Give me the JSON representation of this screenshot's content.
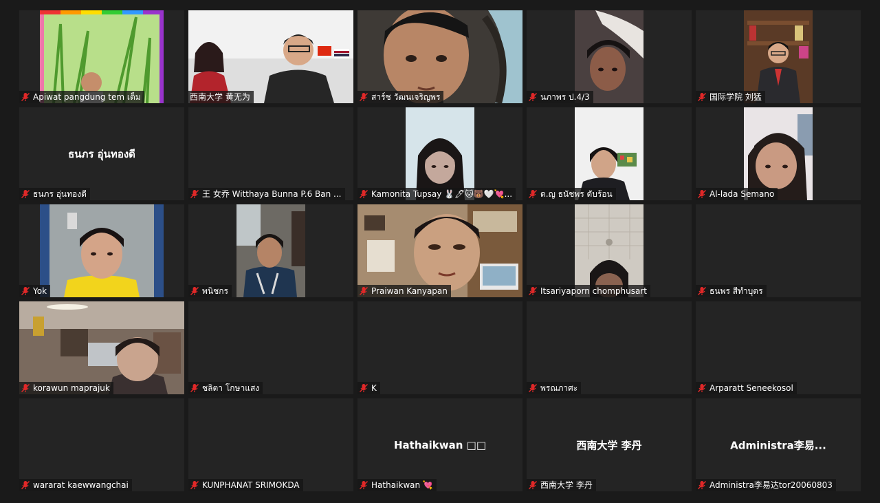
{
  "colors": {
    "background": "#1a1a1a",
    "tile": "#242424",
    "active_speaker_border": "#e5ee6b",
    "muted_icon": "#e02828"
  },
  "participants": [
    {
      "name": "Apiwat pangdung tem เต็ม",
      "muted": true,
      "video": "on",
      "scene": "grass"
    },
    {
      "name": "西南大学 黄无为",
      "muted": false,
      "video": "on",
      "active_speaker": true,
      "scene": "office-flags"
    },
    {
      "name": "สาร์ช วัฒนเจริญพร",
      "muted": true,
      "video": "on",
      "scene": "boy-car"
    },
    {
      "name": "นภาพร  ป.4/3",
      "muted": true,
      "video": "on",
      "scene": "girl-bed"
    },
    {
      "name": "国际学院 刘猛",
      "muted": true,
      "video": "on",
      "scene": "man-bookshelf"
    },
    {
      "name": "ธนภร อุ่นทองดี",
      "center_name": "ธนภร อุ่นทองดี",
      "muted": true,
      "video": "off"
    },
    {
      "name": "王  女乔 Witthaya Bunna P.6 Ban ...",
      "muted": true,
      "video": "off",
      "center_name": ""
    },
    {
      "name": "Kamonita  Tupsay 🐰🖊🐱🐻🤍💘...",
      "muted": true,
      "video": "on",
      "scene": "girl-pale"
    },
    {
      "name": "ด.ญ ธนัชพร ดับร้อน",
      "muted": true,
      "video": "on",
      "scene": "girl-room"
    },
    {
      "name": "Al-lada Semano",
      "muted": true,
      "video": "on",
      "scene": "girl-close"
    },
    {
      "name": "Yok",
      "muted": true,
      "video": "on",
      "scene": "girl-yellow"
    },
    {
      "name": "พนิชกร",
      "muted": true,
      "video": "on",
      "scene": "girl-outdoor"
    },
    {
      "name": "Praiwan Kanyapan",
      "muted": true,
      "video": "on",
      "scene": "man-room"
    },
    {
      "name": "Itsariyaporn chomphusart",
      "muted": true,
      "video": "on",
      "scene": "ceiling"
    },
    {
      "name": "ธนพร สีทำบุตร",
      "muted": true,
      "video": "off",
      "center_name": ""
    },
    {
      "name": "korawun  maprajuk",
      "muted": true,
      "video": "on",
      "scene": "girl-home"
    },
    {
      "name": "ชลิตา โกษาแสง",
      "muted": true,
      "video": "off",
      "center_name": ""
    },
    {
      "name": "K",
      "muted": true,
      "video": "off",
      "center_name": ""
    },
    {
      "name": "พรณภาศะ",
      "muted": true,
      "video": "off",
      "center_name": ""
    },
    {
      "name": "Arparatt Seneekosol",
      "muted": true,
      "video": "off",
      "center_name": ""
    },
    {
      "name": "wararat kaewwangchai",
      "muted": true,
      "video": "off",
      "center_name": ""
    },
    {
      "name": "KUNPHANAT SRIMOKDA",
      "muted": true,
      "video": "off",
      "center_name": ""
    },
    {
      "name": "Hathaikwan 💘",
      "center_name": "Hathaikwan □□",
      "muted": true,
      "video": "off"
    },
    {
      "name": "西南大学 李丹",
      "center_name": "西南大学 李丹",
      "muted": true,
      "video": "off"
    },
    {
      "name": "Administra李易达tor20060803",
      "center_name": "Administra李易...",
      "muted": true,
      "video": "off"
    }
  ]
}
